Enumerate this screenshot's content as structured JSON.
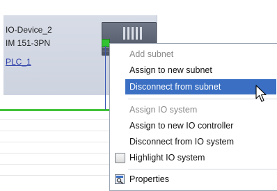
{
  "device": {
    "name": "IO-Device_2",
    "type": "IM 151-3PN",
    "controller_link": "PLC_1"
  },
  "context_menu": {
    "items": [
      {
        "label": "Add subnet",
        "state": "disabled"
      },
      {
        "label": "Assign to new subnet",
        "state": "enabled"
      },
      {
        "label": "Disconnect from subnet",
        "state": "highlighted"
      },
      {
        "label": "Assign IO system",
        "state": "disabled"
      },
      {
        "label": "Assign to new IO controller",
        "state": "enabled"
      },
      {
        "label": "Disconnect from IO system",
        "state": "enabled"
      },
      {
        "label": "Highlight IO system",
        "state": "enabled",
        "icon": "checkbox-icon"
      },
      {
        "label": "Properties",
        "state": "enabled",
        "icon": "properties-icon"
      }
    ]
  },
  "colors": {
    "highlight": "#3a6fc3",
    "subnet_line": "#43c33a",
    "link": "#2b3ea8",
    "device_panel": "#d7dce7"
  },
  "icons": [
    "module-icon",
    "port-icon",
    "checkbox-icon",
    "properties-icon",
    "cursor-icon"
  ]
}
